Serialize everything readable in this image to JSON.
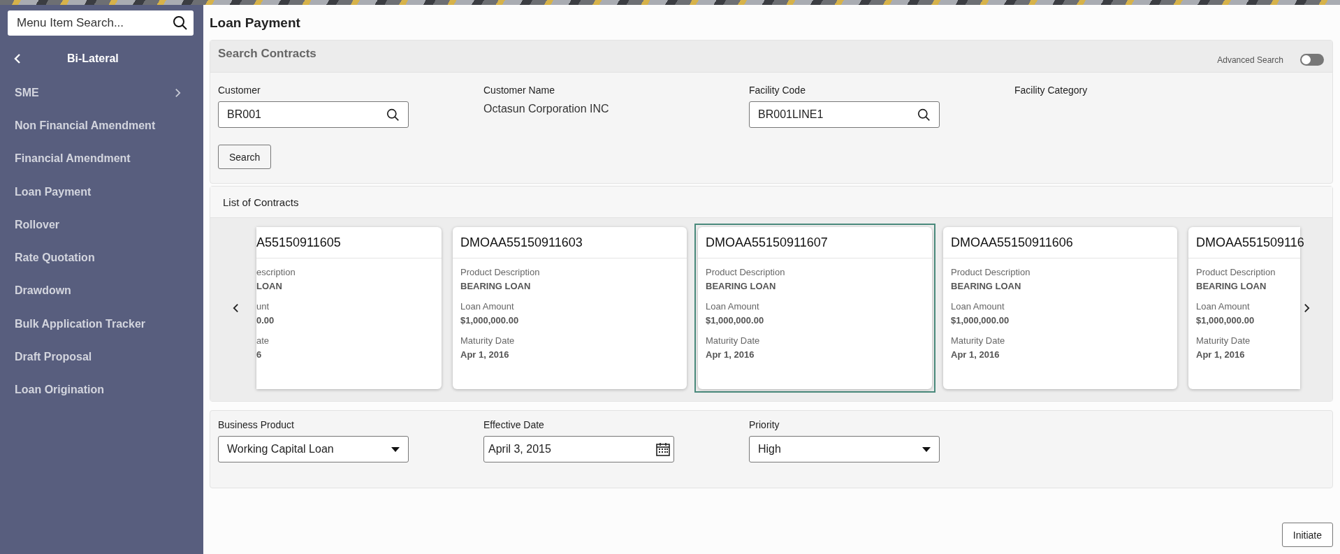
{
  "sidebar": {
    "search": {
      "placeholder": "Menu Item Search..."
    },
    "header": "Bi-Lateral",
    "items": [
      {
        "label": "SME",
        "expandable": true
      },
      {
        "label": "Non Financial Amendment",
        "expandable": false
      },
      {
        "label": "Financial Amendment",
        "expandable": false
      },
      {
        "label": "Loan Payment",
        "expandable": false
      },
      {
        "label": "Rollover",
        "expandable": false
      },
      {
        "label": "Rate Quotation",
        "expandable": false
      },
      {
        "label": "Drawdown",
        "expandable": false
      },
      {
        "label": "Bulk Application Tracker",
        "expandable": false
      },
      {
        "label": "Draft Proposal",
        "expandable": false
      },
      {
        "label": "Loan Origination",
        "expandable": false
      }
    ]
  },
  "page_title": "Loan Payment",
  "search_contracts": {
    "title": "Search Contracts",
    "advanced_search": {
      "label": "Advanced Search",
      "on": false
    },
    "fields": [
      {
        "kind": "lookup",
        "label": "Customer",
        "value": "BR001"
      },
      {
        "kind": "text",
        "label": "Customer Name",
        "value": "Octasun Corporation INC"
      },
      {
        "kind": "lookup",
        "label": "Facility Code",
        "value": "BR001LINE1"
      },
      {
        "kind": "text",
        "label": "Facility Category"
      }
    ],
    "search_button": "Search"
  },
  "contracts": {
    "title": "List of Contracts",
    "cards": [
      {
        "kind": "cut-left",
        "selected": false,
        "title": "A55150911605",
        "fields": [
          {
            "label": "escription",
            "value": "LOAN"
          },
          {
            "label": "unt",
            "value": "0.00"
          },
          {
            "label": "ate",
            "value": "6"
          }
        ]
      },
      {
        "kind": "full",
        "selected": false,
        "title": "DMOAA55150911603",
        "fields": [
          {
            "label": "Product Description",
            "value": "BEARING LOAN"
          },
          {
            "label": "Loan Amount",
            "value": "$1,000,000.00"
          },
          {
            "label": "Maturity Date",
            "value": "Apr 1, 2016"
          }
        ]
      },
      {
        "kind": "full",
        "selected": true,
        "title": "DMOAA55150911607",
        "fields": [
          {
            "label": "Product Description",
            "value": "BEARING LOAN"
          },
          {
            "label": "Loan Amount",
            "value": "$1,000,000.00"
          },
          {
            "label": "Maturity Date",
            "value": "Apr 1, 2016"
          }
        ]
      },
      {
        "kind": "full",
        "selected": false,
        "title": "DMOAA55150911606",
        "fields": [
          {
            "label": "Product Description",
            "value": "BEARING LOAN"
          },
          {
            "label": "Loan Amount",
            "value": "$1,000,000.00"
          },
          {
            "label": "Maturity Date",
            "value": "Apr 1, 2016"
          }
        ]
      },
      {
        "kind": "cut-right",
        "selected": false,
        "title": "DMOAA551509116",
        "fields": [
          {
            "label": "Product Description",
            "value": "BEARING LOAN"
          },
          {
            "label": "Loan Amount",
            "value": "$1,000,000.00"
          },
          {
            "label": "Maturity Date",
            "value": "Apr 1, 2016"
          }
        ]
      }
    ]
  },
  "details": [
    {
      "kind": "dropdown",
      "label": "Business Product",
      "value": "Working Capital Loan"
    },
    {
      "kind": "date",
      "label": "Effective Date",
      "value": "April 3, 2015"
    },
    {
      "kind": "dropdown",
      "label": "Priority",
      "value": "High"
    }
  ],
  "initiate_button": "Initiate"
}
